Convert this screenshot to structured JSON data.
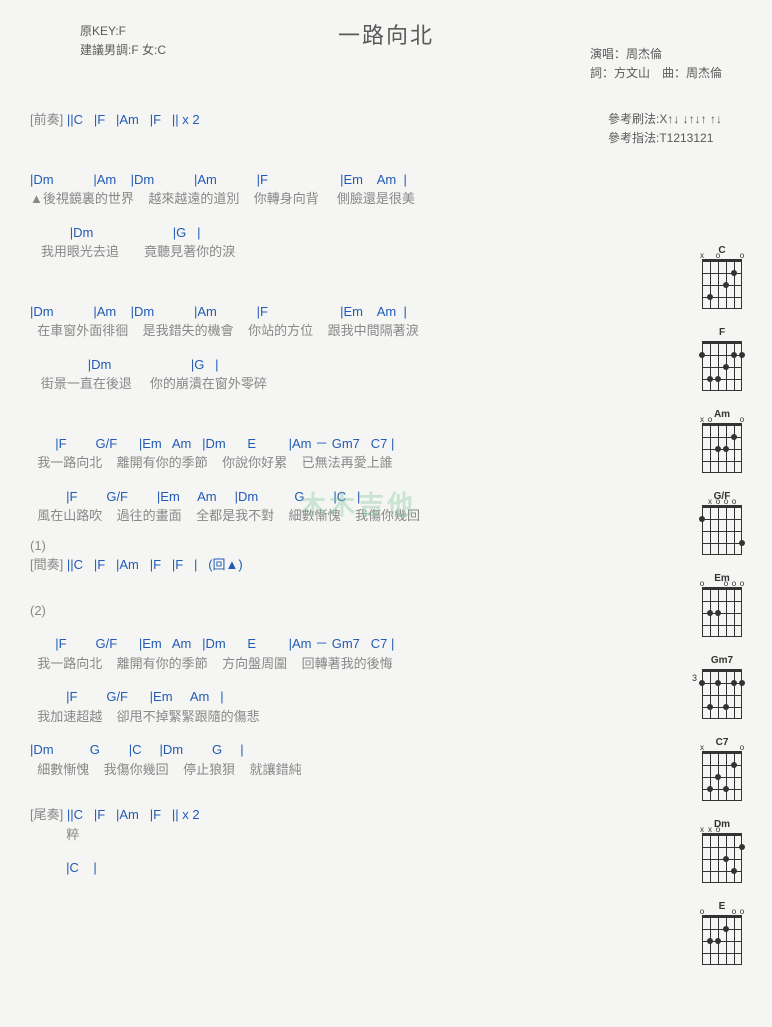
{
  "header": {
    "original_key_label": "原KEY:F",
    "suggest_label": "建議男調:F 女:C",
    "title": "一路向北",
    "performer_label": "演唱：周杰倫",
    "credits_label": "詞：方文山　曲：周杰倫"
  },
  "reference": {
    "strum_label": "參考刷法:X↑↓ ↓↑↓↑ ↑↓",
    "picking_label": "參考指法:T1213121"
  },
  "sections": {
    "intro_label": "[前奏]",
    "intro_chords": " ||C   |F   |Am   |F   || x 2",
    "verse1": [
      {
        "c": "|Dm           |Am    |Dm           |Am           |F                    |Em    Am  |",
        "l": "▲後視鏡裏的世界    越來越遠的道別    你轉身向背     側臉還是很美"
      },
      {
        "c": "           |Dm                      |G   |",
        "l": "   我用眼光去追       竟聽見著你的淚"
      }
    ],
    "verse2": [
      {
        "c": "|Dm           |Am    |Dm           |Am           |F                    |Em    Am  |",
        "l": "  在車窗外面徘徊    是我錯失的機會    你站的方位    跟我中間隔著淚"
      },
      {
        "c": "                |Dm                      |G   |",
        "l": "   街景一直在後退     你的崩潰在窗外零碎"
      }
    ],
    "chorus1": [
      {
        "c": "       |F        G/F      |Em   Am   |Dm      E         |Am － Gm7   C7 |",
        "l": "  我一路向北    離開有你的季節    你說你好累    已無法再愛上誰"
      },
      {
        "c": "          |F        G/F        |Em     Am     |Dm          G        |C   |",
        "l": "  風在山路吹    過往的畫面    全都是我不對    細數慚愧    我傷你幾回"
      }
    ],
    "mark1": "(1)",
    "interlude_label": "[間奏]",
    "interlude_chords": " ||C   |F   |Am   |F   |F   |   (回▲)",
    "mark2": "(2)",
    "chorus2": [
      {
        "c": "       |F        G/F      |Em   Am   |Dm      E         |Am － Gm7   C7 |",
        "l": "  我一路向北    離開有你的季節    方向盤周圍    回轉著我的後悔"
      },
      {
        "c": "          |F        G/F      |Em     Am   |",
        "l": "  我加速超越    卻甩不掉緊緊跟隨的傷悲"
      },
      {
        "c": "|Dm          G        |C     |Dm        G     |",
        "l": "  細數慚愧    我傷你幾回    停止狼狽    就讓錯純"
      }
    ],
    "outro_label": "[尾奏]",
    "outro_chords": " ||C   |F   |Am   |F   || x 2",
    "outro_lyric": "          粹",
    "outro_end": "          |C    |"
  },
  "chord_names": [
    "C",
    "F",
    "Am",
    "G/F",
    "Em",
    "Gm7",
    "C7",
    "Dm",
    "E"
  ],
  "watermark": "木木吉他"
}
